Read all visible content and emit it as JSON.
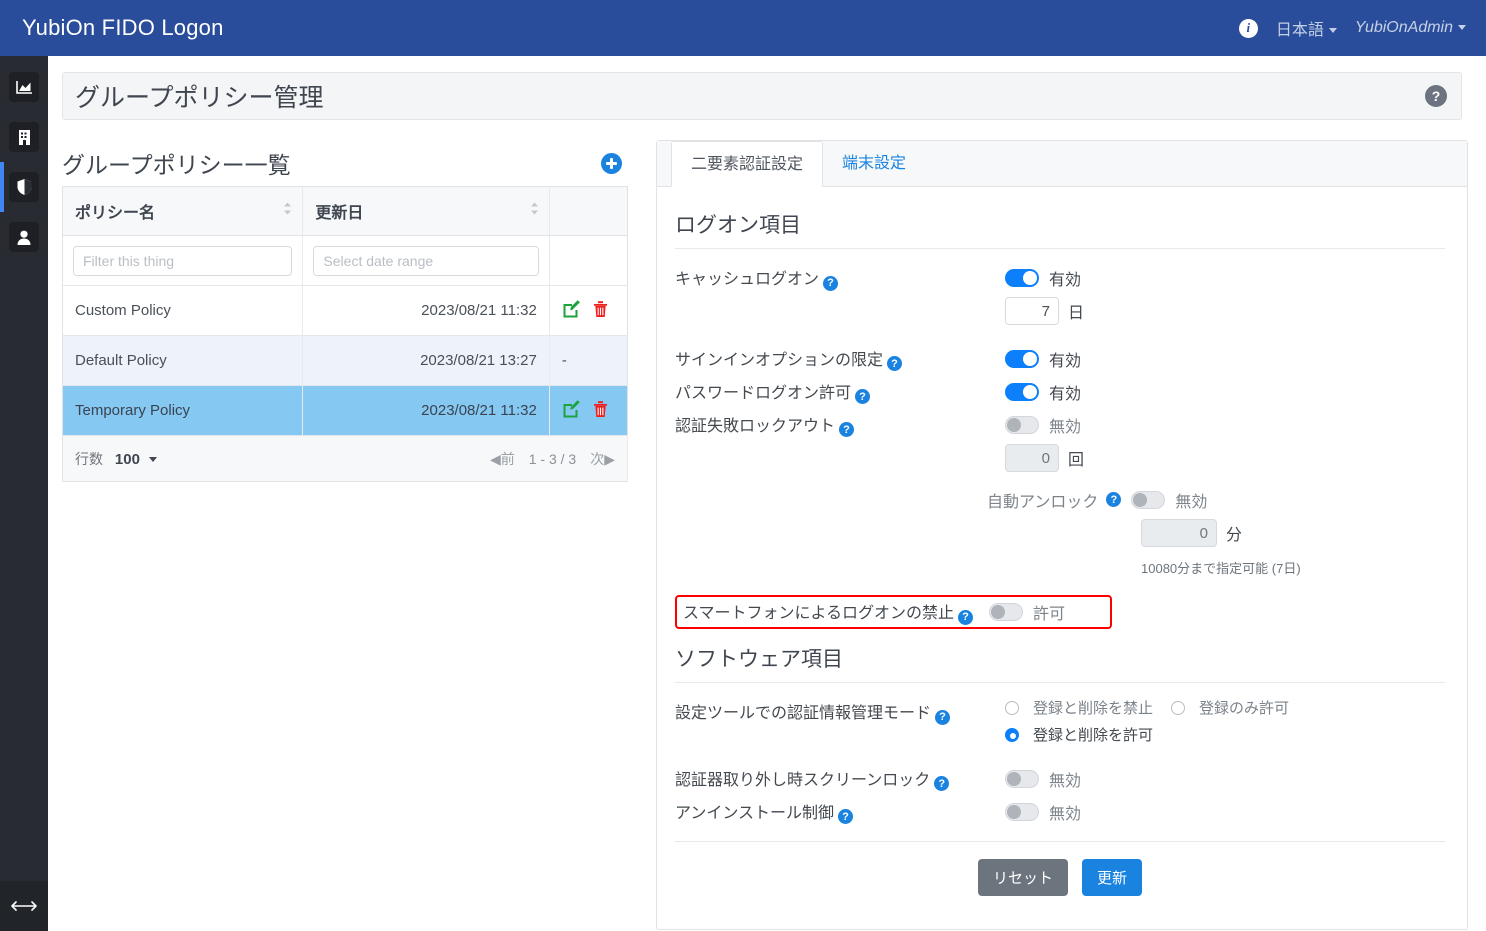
{
  "navbar": {
    "brand": "YubiOn FIDO Logon",
    "info_icon": "info-icon",
    "language": "日本語",
    "user": "YubiOnAdmin"
  },
  "sidebar": {
    "items": [
      {
        "icon": "chart-icon",
        "name": "sidebar-item-dashboard",
        "active": false
      },
      {
        "icon": "building-icon",
        "name": "sidebar-item-organization",
        "active": false
      },
      {
        "icon": "shield-icon",
        "name": "sidebar-item-policy",
        "active": true
      },
      {
        "icon": "user-icon",
        "name": "sidebar-item-users",
        "active": false
      }
    ],
    "expand_icon": "expand-collapse-icon"
  },
  "page": {
    "title": "グループポリシー管理",
    "help_icon": "help-icon"
  },
  "list": {
    "title": "グループポリシー一覧",
    "add_icon": "add-circle-icon",
    "columns": [
      "ポリシー名",
      "更新日",
      ""
    ],
    "filters": {
      "name_placeholder": "Filter this thing",
      "name_value": "",
      "date_placeholder": "Select date range",
      "date_value": ""
    },
    "rows": [
      {
        "name": "Custom Policy",
        "date": "2023/08/21 11:32",
        "actions": "edit-delete",
        "selected": false
      },
      {
        "name": "Default Policy",
        "date": "2023/08/21 13:27",
        "actions": "-",
        "selected": false
      },
      {
        "name": "Temporary Policy",
        "date": "2023/08/21 11:32",
        "actions": "edit-delete",
        "selected": true
      }
    ],
    "footer": {
      "rows_label": "行数",
      "rows_value": "100",
      "prev": "前",
      "range": "1 - 3 / 3",
      "next": "次"
    }
  },
  "settings": {
    "tabs": [
      {
        "label": "二要素認証設定",
        "active": true
      },
      {
        "label": "端末設定",
        "active": false
      }
    ],
    "logon_section": {
      "title": "ログオン項目",
      "cache_logon": {
        "label": "キャッシュログオン",
        "state": "有効",
        "on": true,
        "value": "7",
        "unit": "日"
      },
      "signin_option": {
        "label": "サインインオプションの限定",
        "state": "有効",
        "on": true
      },
      "password_logon": {
        "label": "パスワードログオン許可",
        "state": "有効",
        "on": true
      },
      "auth_lockout": {
        "label": "認証失敗ロックアウト",
        "state": "無効",
        "on": false,
        "value": "0",
        "unit": "回"
      },
      "auto_unlock": {
        "label": "自動アンロック",
        "state": "無効",
        "on": false,
        "value": "0",
        "unit": "分",
        "hint": "10080分まで指定可能 (7日)"
      },
      "smartphone_ban": {
        "label": "スマートフォンによるログオンの禁止",
        "state": "許可",
        "on": false,
        "highlighted": true
      }
    },
    "software_section": {
      "title": "ソフトウェア項目",
      "cred_mode": {
        "label": "設定ツールでの認証情報管理モード",
        "options": [
          {
            "label": "登録と削除を禁止",
            "selected": false
          },
          {
            "label": "登録のみ許可",
            "selected": false
          },
          {
            "label": "登録と削除を許可",
            "selected": true
          }
        ]
      },
      "screen_lock": {
        "label": "認証器取り外し時スクリーンロック",
        "state": "無効",
        "on": false
      },
      "uninstall_control": {
        "label": "アンインストール制御",
        "state": "無効",
        "on": false
      }
    },
    "buttons": {
      "reset": "リセット",
      "update": "更新"
    }
  },
  "colors": {
    "navbar": "#2a4d9b",
    "accent_blue": "#1a83e0",
    "toggle_on": "#0d7ffb",
    "selected_row": "#85c8f2",
    "highlight": "#ff0000",
    "reset_button": "#6c757d"
  }
}
